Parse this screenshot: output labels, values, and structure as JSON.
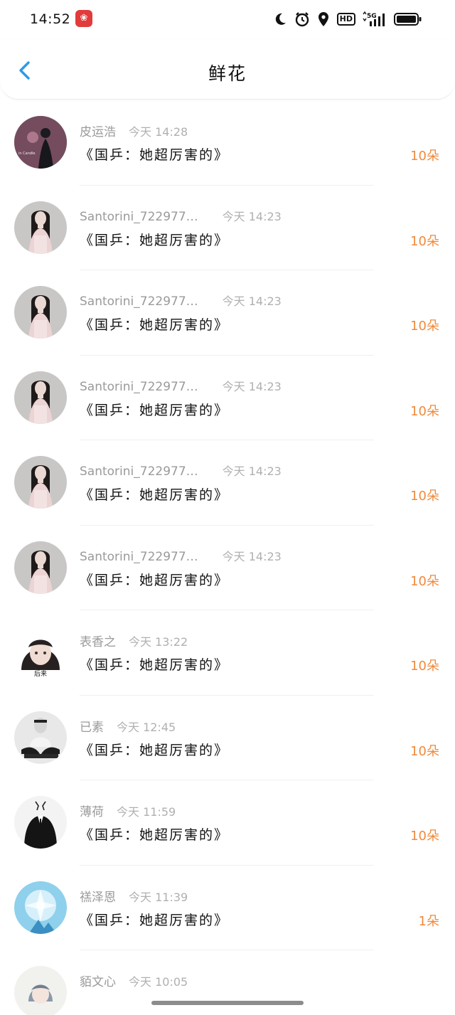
{
  "status_bar": {
    "time": "14:52",
    "network": "5G"
  },
  "header": {
    "title": "鲜花"
  },
  "colors": {
    "accent": "#2a9ae8",
    "count": "#f08a3c",
    "meta": "#a8a8a8"
  },
  "items": [
    {
      "name": "皮运浩",
      "time": "今天 14:28",
      "title": "《国乒：她超厉害的》",
      "count": "10朵",
      "avatar": "avatar-dark-portrait"
    },
    {
      "name": "Santorini_722977…",
      "time": "今天 14:23",
      "title": "《国乒：她超厉害的》",
      "count": "10朵",
      "avatar": "avatar-woman"
    },
    {
      "name": "Santorini_722977…",
      "time": "今天 14:23",
      "title": "《国乒：她超厉害的》",
      "count": "10朵",
      "avatar": "avatar-woman"
    },
    {
      "name": "Santorini_722977…",
      "time": "今天 14:23",
      "title": "《国乒：她超厉害的》",
      "count": "10朵",
      "avatar": "avatar-woman"
    },
    {
      "name": "Santorini_722977…",
      "time": "今天 14:23",
      "title": "《国乒：她超厉害的》",
      "count": "10朵",
      "avatar": "avatar-woman"
    },
    {
      "name": "Santorini_722977…",
      "time": "今天 14:23",
      "title": "《国乒：她超厉害的》",
      "count": "10朵",
      "avatar": "avatar-woman"
    },
    {
      "name": "表香之",
      "time": "今天 13:22",
      "title": "《国乒：她超厉害的》",
      "count": "10朵",
      "avatar": "avatar-girl-caption",
      "caption": "后来"
    },
    {
      "name": "已素",
      "time": "今天 12:45",
      "title": "《国乒：她超厉害的》",
      "count": "10朵",
      "avatar": "avatar-sitting-person"
    },
    {
      "name": "薄荷",
      "time": "今天 11:59",
      "title": "《国乒：她超厉害的》",
      "count": "10朵",
      "avatar": "avatar-suit-figure"
    },
    {
      "name": "禚泽恩",
      "time": "今天 11:39",
      "title": "《国乒：她超厉害的》",
      "count": "1朵",
      "avatar": "avatar-blue-crystal"
    },
    {
      "name": "貊文心",
      "time": "今天 10:05",
      "title": "",
      "count": "",
      "avatar": "avatar-anime"
    }
  ]
}
